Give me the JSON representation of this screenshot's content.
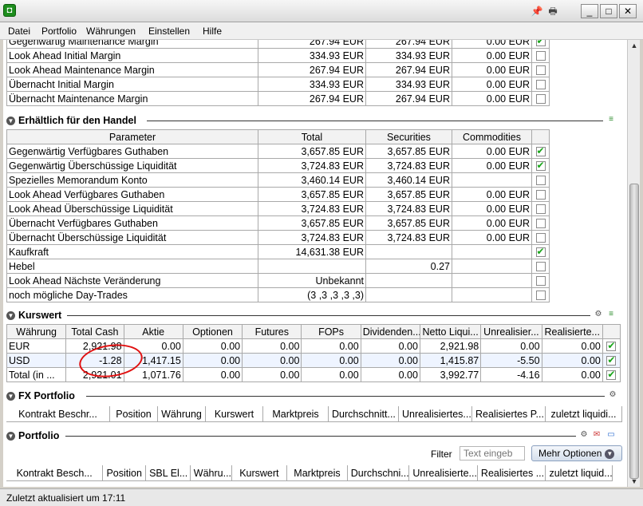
{
  "menu": [
    "Datei",
    "Portfolio",
    "Währungen",
    "Einstellen",
    "Hilfe"
  ],
  "margin_rows": [
    {
      "label": "Gegenwärtig Maintenance Margin",
      "total": "267.94 EUR",
      "securities": "267.94 EUR",
      "commodities": "0.00 EUR",
      "checked": true
    },
    {
      "label": "Look Ahead Initial Margin",
      "total": "334.93 EUR",
      "securities": "334.93 EUR",
      "commodities": "0.00 EUR",
      "checked": false
    },
    {
      "label": "Look Ahead Maintenance Margin",
      "total": "267.94 EUR",
      "securities": "267.94 EUR",
      "commodities": "0.00 EUR",
      "checked": false
    },
    {
      "label": "Übernacht Initial Margin",
      "total": "334.93 EUR",
      "securities": "334.93 EUR",
      "commodities": "0.00 EUR",
      "checked": false
    },
    {
      "label": "Übernacht Maintenance Margin",
      "total": "267.94 EUR",
      "securities": "267.94 EUR",
      "commodities": "0.00 EUR",
      "checked": false
    }
  ],
  "handel": {
    "title": "Erhältlich für den Handel",
    "headers": [
      "Parameter",
      "Total",
      "Securities",
      "Commodities"
    ],
    "rows": [
      {
        "label": "Gegenwärtig Verfügbares Guthaben",
        "total": "3,657.85 EUR",
        "securities": "3,657.85 EUR",
        "commodities": "0.00 EUR",
        "checked": true
      },
      {
        "label": "Gegenwärtig Überschüssige Liquidität",
        "total": "3,724.83 EUR",
        "securities": "3,724.83 EUR",
        "commodities": "0.00 EUR",
        "checked": true
      },
      {
        "label": "Spezielles Memorandum Konto",
        "total": "3,460.14 EUR",
        "securities": "3,460.14 EUR",
        "commodities": "",
        "checked": false
      },
      {
        "label": "Look Ahead Verfügbares Guthaben",
        "total": "3,657.85 EUR",
        "securities": "3,657.85 EUR",
        "commodities": "0.00 EUR",
        "checked": false
      },
      {
        "label": "Look Ahead Überschüssige Liquidität",
        "total": "3,724.83 EUR",
        "securities": "3,724.83 EUR",
        "commodities": "0.00 EUR",
        "checked": false
      },
      {
        "label": "Übernacht Verfügbares Guthaben",
        "total": "3,657.85 EUR",
        "securities": "3,657.85 EUR",
        "commodities": "0.00 EUR",
        "checked": false
      },
      {
        "label": "Übernacht Überschüssige Liquidität",
        "total": "3,724.83 EUR",
        "securities": "3,724.83 EUR",
        "commodities": "0.00 EUR",
        "checked": false
      },
      {
        "label": "Kaufkraft",
        "total": "14,631.38 EUR",
        "securities": "",
        "commodities": "",
        "checked": true
      },
      {
        "label": "Hebel",
        "total": "",
        "securities": "0.27",
        "commodities": "",
        "checked": false
      },
      {
        "label": "Look Ahead Nächste Veränderung",
        "total": "Unbekannt",
        "securities": "",
        "commodities": "",
        "checked": false
      },
      {
        "label": "noch mögliche Day-Trades",
        "total": "(3 ,3 ,3 ,3 ,3)",
        "securities": "",
        "commodities": "",
        "checked": false
      }
    ]
  },
  "kurswert": {
    "title": "Kurswert",
    "headers": [
      "Währung",
      "Total Cash",
      "Aktie",
      "Optionen",
      "Futures",
      "FOPs",
      "Dividenden...",
      "Netto Liqui...",
      "Unrealisier...",
      "Realisierte..."
    ],
    "rows": [
      {
        "cells": [
          "EUR",
          "2,921.98",
          "0.00",
          "0.00",
          "0.00",
          "0.00",
          "0.00",
          "2,921.98",
          "0.00",
          "0.00"
        ],
        "checked": true
      },
      {
        "cells": [
          "USD",
          "-1.28",
          "1,417.15",
          "0.00",
          "0.00",
          "0.00",
          "0.00",
          "1,415.87",
          "-5.50",
          "0.00"
        ],
        "checked": true
      },
      {
        "cells": [
          "Total (in ...",
          "2,921.01",
          "1,071.76",
          "0.00",
          "0.00",
          "0.00",
          "0.00",
          "3,992.77",
          "-4.16",
          "0.00"
        ],
        "checked": true
      }
    ]
  },
  "fx": {
    "title": "FX Portfolio",
    "headers": [
      "Kontrakt Beschr...",
      "Position",
      "Währung",
      "Kurswert",
      "Marktpreis",
      "Durchschnitt...",
      "Unrealisiertes...",
      "Realisiertes P...",
      "zuletzt liquidi..."
    ]
  },
  "portfolio": {
    "title": "Portfolio",
    "filter_label": "Filter",
    "filter_placeholder": "Text eingeb",
    "more_options": "Mehr Optionen",
    "headers": [
      "Kontrakt Besch...",
      "Position",
      "SBL El...",
      "Währu...",
      "Kurswert",
      "Marktpreis",
      "Durchschni...",
      "Unrealisierte...",
      "Realisiertes ...",
      "zuletzt liquid..."
    ]
  },
  "status": "Zuletzt aktualisiert um 17:11"
}
